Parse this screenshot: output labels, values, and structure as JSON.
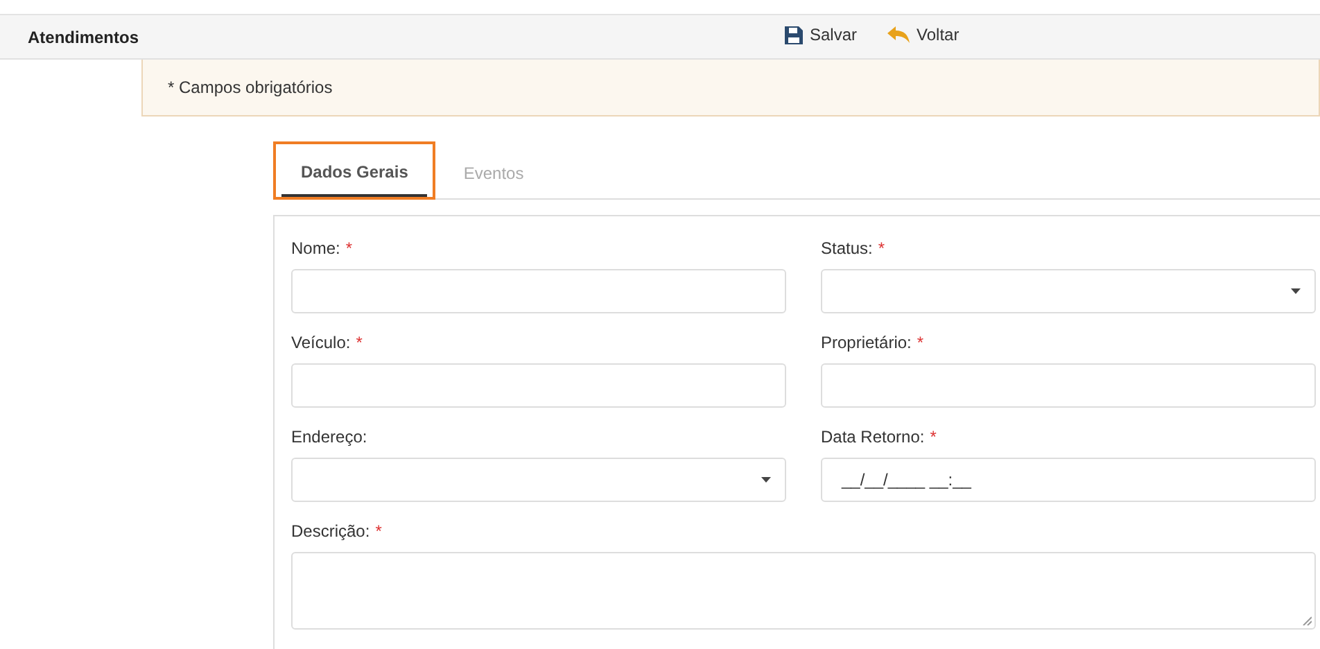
{
  "header": {
    "title": "Atendimentos",
    "actions": [
      {
        "label": "Salvar",
        "kind": "save"
      },
      {
        "label": "Voltar",
        "kind": "back"
      }
    ]
  },
  "notice": "* Campos obrigatórios",
  "tabs": [
    {
      "label": "Dados Gerais",
      "selected": true,
      "highlighted": true
    },
    {
      "label": "Eventos",
      "selected": false,
      "highlighted": false
    }
  ],
  "fields": [
    {
      "label": "Nome:",
      "required_mark": "*",
      "kind": "text"
    },
    {
      "label": "Status:",
      "required_mark": "*",
      "kind": "select"
    },
    {
      "label": "Veículo:",
      "required_mark": "*",
      "kind": "text"
    },
    {
      "label": "Proprietário:",
      "required_mark": "*",
      "kind": "text"
    },
    {
      "label": "Endereço:",
      "kind": "select"
    },
    {
      "label": "Data Retorno:",
      "required_mark": "*",
      "kind": "mask",
      "value": "__/__/____ __:__"
    },
    {
      "label": "Descrição:",
      "required_mark": "*",
      "kind": "textarea"
    }
  ]
}
